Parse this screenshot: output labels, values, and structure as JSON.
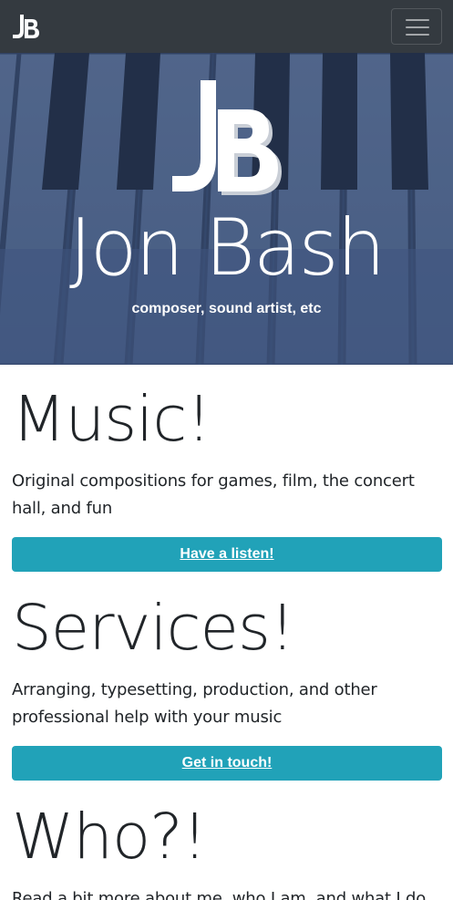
{
  "navbar": {
    "logo_text": "JB",
    "toggler_label": "Toggle navigation"
  },
  "hero": {
    "logo_text": "JB",
    "title": "Jon Bash",
    "subtitle": "composer, sound artist, etc"
  },
  "sections": [
    {
      "heading": "Music!",
      "text": "Original compositions for games, film, the concert hall, and fun",
      "button_label": "Have a listen!"
    },
    {
      "heading": "Services!",
      "text": "Arranging, typesetting, production, and other professional help with your music",
      "button_label": "Get in touch!"
    },
    {
      "heading": "Who?!",
      "text": "Read a bit more about me, who I am, and what I do"
    }
  ],
  "colors": {
    "navbar_bg": "#343a40",
    "hero_overlay": "#3e5478",
    "button_bg": "#21a2b8",
    "text": "#212529"
  }
}
